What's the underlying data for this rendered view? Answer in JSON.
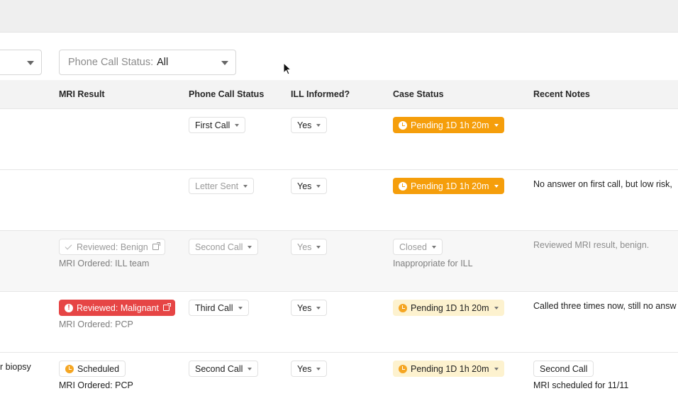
{
  "filters": {
    "phone_call_status_label": "Phone Call Status:",
    "phone_call_status_value": "All"
  },
  "columns": {
    "mri_result": "MRI Result",
    "phone_call_status": "Phone Call Status",
    "ill_informed": "ILL Informed?",
    "case_status": "Case Status",
    "recent_notes": "Recent Notes"
  },
  "rows": [
    {
      "phone_call_status": "First Call",
      "ill_informed": "Yes",
      "case_status": "Pending 1D 1h 20m"
    },
    {
      "phone_call_status": "Letter Sent",
      "ill_informed": "Yes",
      "case_status": "Pending 1D 1h 20m",
      "recent_notes": "No answer on first call, but low risk, "
    },
    {
      "mri_result": "Reviewed: Benign",
      "mri_ordered": "MRI Ordered: ILL team",
      "phone_call_status": "Second Call",
      "ill_informed": "Yes",
      "case_status": "Closed",
      "case_status_sub": "Inappropriate for ILL",
      "recent_notes": "Reviewed MRI result, benign."
    },
    {
      "mri_result": "Reviewed: Malignant",
      "mri_ordered": "MRI Ordered: PCP",
      "phone_call_status": "Third Call",
      "ill_informed": "Yes",
      "case_status": "Pending 1D 1h 20m",
      "recent_notes": "Called three times now, still no answ"
    },
    {
      "left_text": "r biopsy",
      "mri_result": "Scheduled",
      "mri_ordered": "MRI Ordered: PCP",
      "phone_call_status": "Second Call",
      "ill_informed": "Yes",
      "case_status": "Pending 1D 1h 20m",
      "notes_tag": "Second Call",
      "recent_notes": "MRI scheduled for 11/11"
    }
  ],
  "colors": {
    "pending_active": "#f59e0b",
    "pending_soft": "#fdf2cf",
    "malignant": "#e64545"
  },
  "icons": [
    "caret-down-icon",
    "clock-icon",
    "alert-icon",
    "external-link-icon",
    "check-icon",
    "mouse-cursor-icon"
  ]
}
